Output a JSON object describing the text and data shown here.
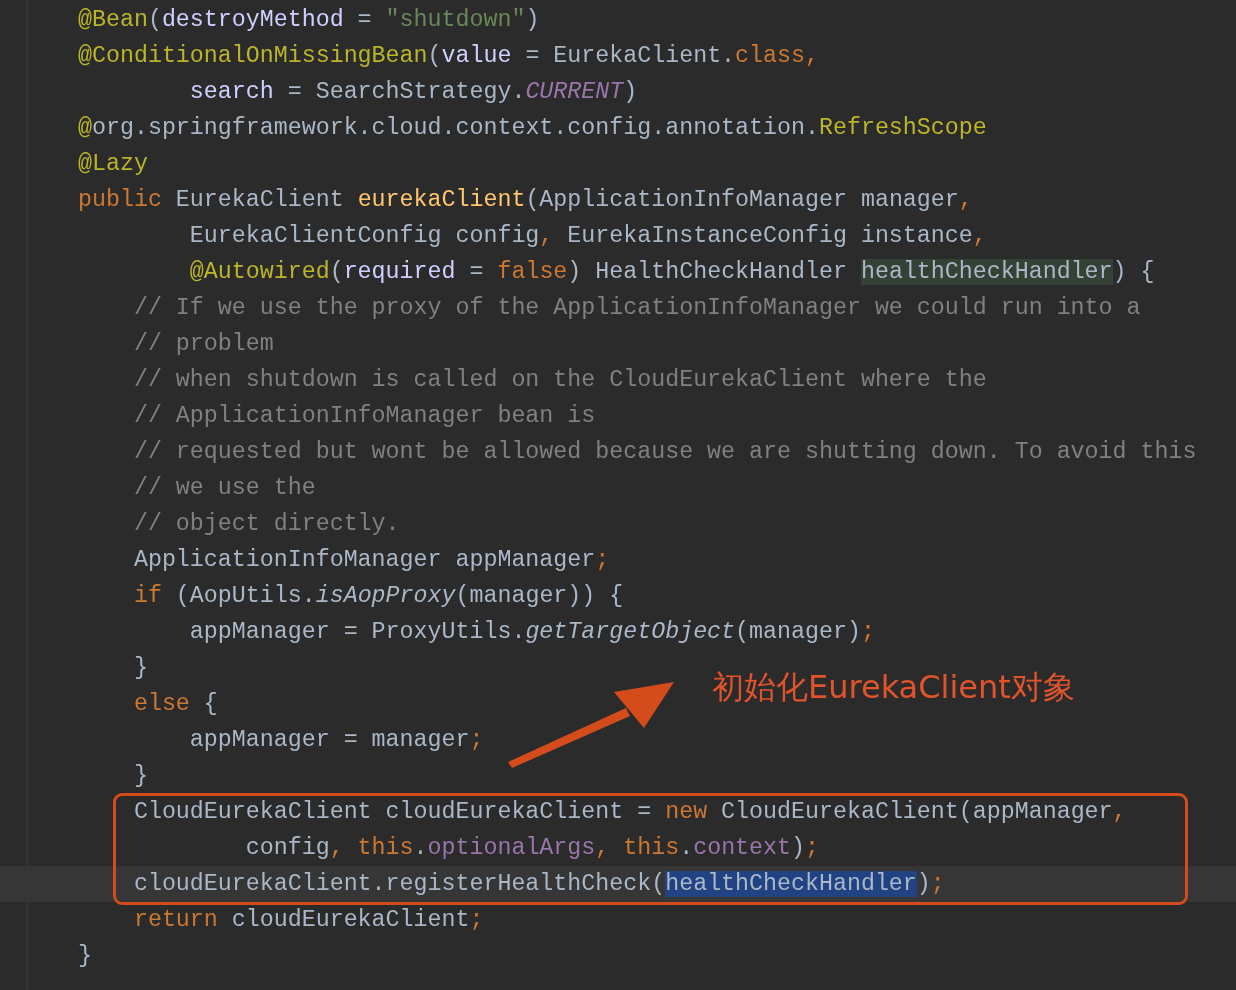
{
  "lines": [
    {
      "current": false,
      "tokens": [
        {
          "text": "@Bean",
          "kind": "annotation"
        },
        {
          "text": "(",
          "kind": "plain"
        },
        {
          "text": "destroyMethod",
          "kind": "param"
        },
        {
          "text": " = ",
          "kind": "plain"
        },
        {
          "text": "\"shutdown\"",
          "kind": "string"
        },
        {
          "text": ")",
          "kind": "plain"
        }
      ]
    },
    {
      "current": false,
      "tokens": [
        {
          "text": "@ConditionalOnMissingBean",
          "kind": "annotation"
        },
        {
          "text": "(",
          "kind": "plain"
        },
        {
          "text": "value",
          "kind": "param"
        },
        {
          "text": " = EurekaClient.",
          "kind": "plain"
        },
        {
          "text": "class,",
          "kind": "keyword"
        }
      ]
    },
    {
      "current": false,
      "tokens": [
        {
          "text": "        search",
          "kind": "param"
        },
        {
          "text": " = SearchStrategy.",
          "kind": "plain"
        },
        {
          "text": "CURRENT",
          "kind": "static"
        },
        {
          "text": ")",
          "kind": "plain"
        }
      ]
    },
    {
      "current": false,
      "tokens": [
        {
          "text": "@",
          "kind": "annotation"
        },
        {
          "text": "org.springframework.cloud.context.config.annotation.",
          "kind": "plain"
        },
        {
          "text": "RefreshScope",
          "kind": "annotation"
        }
      ]
    },
    {
      "current": false,
      "tokens": [
        {
          "text": "@Lazy",
          "kind": "annotation"
        }
      ]
    },
    {
      "current": false,
      "tokens": [
        {
          "text": "public",
          "kind": "keyword"
        },
        {
          "text": " EurekaClient ",
          "kind": "plain"
        },
        {
          "text": "eurekaClient",
          "kind": "method"
        },
        {
          "text": "(ApplicationInfoManager manager",
          "kind": "plain"
        },
        {
          "text": ",",
          "kind": "keyword"
        }
      ]
    },
    {
      "current": false,
      "tokens": [
        {
          "text": "        EurekaClientConfig config",
          "kind": "plain"
        },
        {
          "text": ",",
          "kind": "keyword"
        },
        {
          "text": " EurekaInstanceConfig instance",
          "kind": "plain"
        },
        {
          "text": ",",
          "kind": "keyword"
        }
      ]
    },
    {
      "current": false,
      "tokens": [
        {
          "text": "        @Autowired",
          "kind": "annotation"
        },
        {
          "text": "(",
          "kind": "plain"
        },
        {
          "text": "required",
          "kind": "param"
        },
        {
          "text": " = ",
          "kind": "plain"
        },
        {
          "text": "false",
          "kind": "keyword"
        },
        {
          "text": ") HealthCheckHandler ",
          "kind": "plain"
        },
        {
          "text": "healthCheckHandler",
          "kind": "usage"
        },
        {
          "text": ") {",
          "kind": "plain"
        }
      ]
    },
    {
      "current": false,
      "tokens": [
        {
          "text": "    // If we use the proxy of the ApplicationInfoManager we could run into a",
          "kind": "comment"
        }
      ]
    },
    {
      "current": false,
      "tokens": [
        {
          "text": "    // problem",
          "kind": "comment"
        }
      ]
    },
    {
      "current": false,
      "tokens": [
        {
          "text": "    // when shutdown is called on the CloudEurekaClient where the",
          "kind": "comment"
        }
      ]
    },
    {
      "current": false,
      "tokens": [
        {
          "text": "    // ApplicationInfoManager bean is",
          "kind": "comment"
        }
      ]
    },
    {
      "current": false,
      "tokens": [
        {
          "text": "    // requested but wont be allowed because we are shutting down. To avoid this",
          "kind": "comment"
        }
      ]
    },
    {
      "current": false,
      "tokens": [
        {
          "text": "    // we use the",
          "kind": "comment"
        }
      ]
    },
    {
      "current": false,
      "tokens": [
        {
          "text": "    // object directly.",
          "kind": "comment"
        }
      ]
    },
    {
      "current": false,
      "tokens": [
        {
          "text": "    ApplicationInfoManager appManager",
          "kind": "plain"
        },
        {
          "text": ";",
          "kind": "keyword"
        }
      ]
    },
    {
      "current": false,
      "tokens": [
        {
          "text": "    if",
          "kind": "keyword"
        },
        {
          "text": " (AopUtils.",
          "kind": "plain"
        },
        {
          "text": "isAopProxy",
          "kind": "call"
        },
        {
          "text": "(manager)) {",
          "kind": "plain"
        }
      ]
    },
    {
      "current": false,
      "tokens": [
        {
          "text": "        appManager = ProxyUtils.",
          "kind": "plain"
        },
        {
          "text": "getTargetObject",
          "kind": "call"
        },
        {
          "text": "(manager)",
          "kind": "plain"
        },
        {
          "text": ";",
          "kind": "keyword"
        }
      ]
    },
    {
      "current": false,
      "tokens": [
        {
          "text": "    }",
          "kind": "plain"
        }
      ]
    },
    {
      "current": false,
      "tokens": [
        {
          "text": "    else",
          "kind": "keyword"
        },
        {
          "text": " {",
          "kind": "plain"
        }
      ]
    },
    {
      "current": false,
      "tokens": [
        {
          "text": "        appManager = manager",
          "kind": "plain"
        },
        {
          "text": ";",
          "kind": "keyword"
        }
      ]
    },
    {
      "current": false,
      "tokens": [
        {
          "text": "    }",
          "kind": "plain"
        }
      ]
    },
    {
      "current": false,
      "tokens": [
        {
          "text": "    CloudEurekaClient cloudEurekaClient = ",
          "kind": "plain"
        },
        {
          "text": "new",
          "kind": "keyword"
        },
        {
          "text": " CloudEurekaClient(appManager",
          "kind": "plain"
        },
        {
          "text": ",",
          "kind": "keyword"
        }
      ]
    },
    {
      "current": false,
      "tokens": [
        {
          "text": "            config",
          "kind": "plain"
        },
        {
          "text": ", this",
          "kind": "keyword"
        },
        {
          "text": ".",
          "kind": "plain"
        },
        {
          "text": "optionalArgs",
          "kind": "field"
        },
        {
          "text": ", this",
          "kind": "keyword"
        },
        {
          "text": ".",
          "kind": "plain"
        },
        {
          "text": "context",
          "kind": "field"
        },
        {
          "text": ")",
          "kind": "plain"
        },
        {
          "text": ";",
          "kind": "keyword"
        }
      ]
    },
    {
      "current": true,
      "tokens": [
        {
          "text": "    cloudEurekaClient.registerHealthCheck(",
          "kind": "plain"
        },
        {
          "text": "healthCheckHandler",
          "kind": "selection"
        },
        {
          "text": ")",
          "kind": "plain"
        },
        {
          "text": ";",
          "kind": "keyword"
        }
      ]
    },
    {
      "current": false,
      "tokens": [
        {
          "text": "    return",
          "kind": "keyword"
        },
        {
          "text": " cloudEurekaClient",
          "kind": "plain"
        },
        {
          "text": ";",
          "kind": "keyword"
        }
      ]
    },
    {
      "current": false,
      "tokens": [
        {
          "text": "}",
          "kind": "plain"
        }
      ]
    }
  ],
  "annotation": {
    "text": "初始化EurekaClient对象"
  }
}
